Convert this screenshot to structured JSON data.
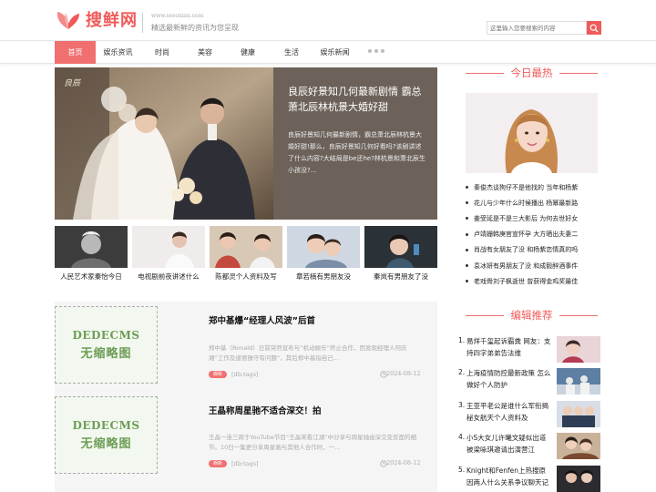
{
  "header": {
    "logo_text": "搜鲜网",
    "site_url": "www.sosoxian.com",
    "slogan": "精选最新鲜的资讯为您呈现",
    "search_placeholder": "这里输入您要搜索的内容"
  },
  "nav": {
    "items": [
      "首页",
      "娱乐资讯",
      "时尚",
      "美容",
      "健康",
      "生活",
      "娱乐新闻"
    ]
  },
  "banner": {
    "title": "良辰好景知几何最新剧情 霸总萧北辰林杭景大婚好甜",
    "desc": "良辰好景知几何最新剧情，霸总萧北辰林杭景大婚好甜!那么，良辰好景知几何好看吗?该剧讲述了什么内容?大结局是be还he?林杭景和萧北辰生小孩没?..."
  },
  "thumbs": [
    "人民艺术家秦怡今日",
    "电视剧前夜讲述什么",
    "陈都灵个人资料及写",
    "章若楠有男朋友没",
    "秦岚有男朋友了没"
  ],
  "articles": [
    {
      "img_line1": "DEDECMS",
      "img_line2": "无缩略图",
      "title": "郑中基爆“经理人风波”后首",
      "desc": "郑中基（Ronald）日前突然宣布与“机动娱乐”终止合作，因发现经理人何庆湘“工作及道德操守有问题”，其后郑中基指自己...",
      "tag": "娱新",
      "category": "[db:tags]",
      "date": "2024-08-12"
    },
    {
      "img_line1": "DEDECMS",
      "img_line2": "无缩略图",
      "title": "王晶称周星驰不适合深交！拍",
      "desc": "王晶一连三周于YouTube节目“王晶笑看江湖”中分享与周星驰由深交变反面的细节。10日一集更分享周星驰与其他人合作时，一...",
      "tag": "娱新",
      "category": "[db:tags]",
      "date": "2024-08-12"
    }
  ],
  "sidebar": {
    "hot_title": "今日最热",
    "hot_items": [
      "秦俊杰谈狗仔不是他找的 当年和杨紫",
      "花儿与少年什么时候播出 杨幂最新路",
      "姜受延是不是三大影后 为何去世好女",
      "卢靖姗韩庚官宣怀孕 大方晒出夫妻二",
      "肖战有女朋友了没 和杨紫恋情真的吗",
      "袁冰妍有男朋友了没 和成毅醉酒事件",
      "老戏骨刘子枫逝世 曾获得金鸡奖最佳"
    ],
    "rec_title": "编辑推荐",
    "rec_items": [
      {
        "num": "1.",
        "title": "易烊千玺起诉霸粪 网友：支持四字弟弟告法维"
      },
      {
        "num": "2.",
        "title": "上海疫情防控最新政策 怎么做好个人防护"
      },
      {
        "num": "3.",
        "title": "王亚平老公是谁什么军衔揭秘女航天个人资料及"
      },
      {
        "num": "4.",
        "title": "小S大女儿许曦文疑似出道被梁咏琪邀请出演营江"
      },
      {
        "num": "5.",
        "title": "Knight和Fenfen上热搜原因两人什么关系争议聊天记"
      }
    ]
  },
  "colors": {
    "accent": "#f05a5a",
    "nav_active": "#f07070",
    "placeholder_green": "#6d9d55"
  }
}
